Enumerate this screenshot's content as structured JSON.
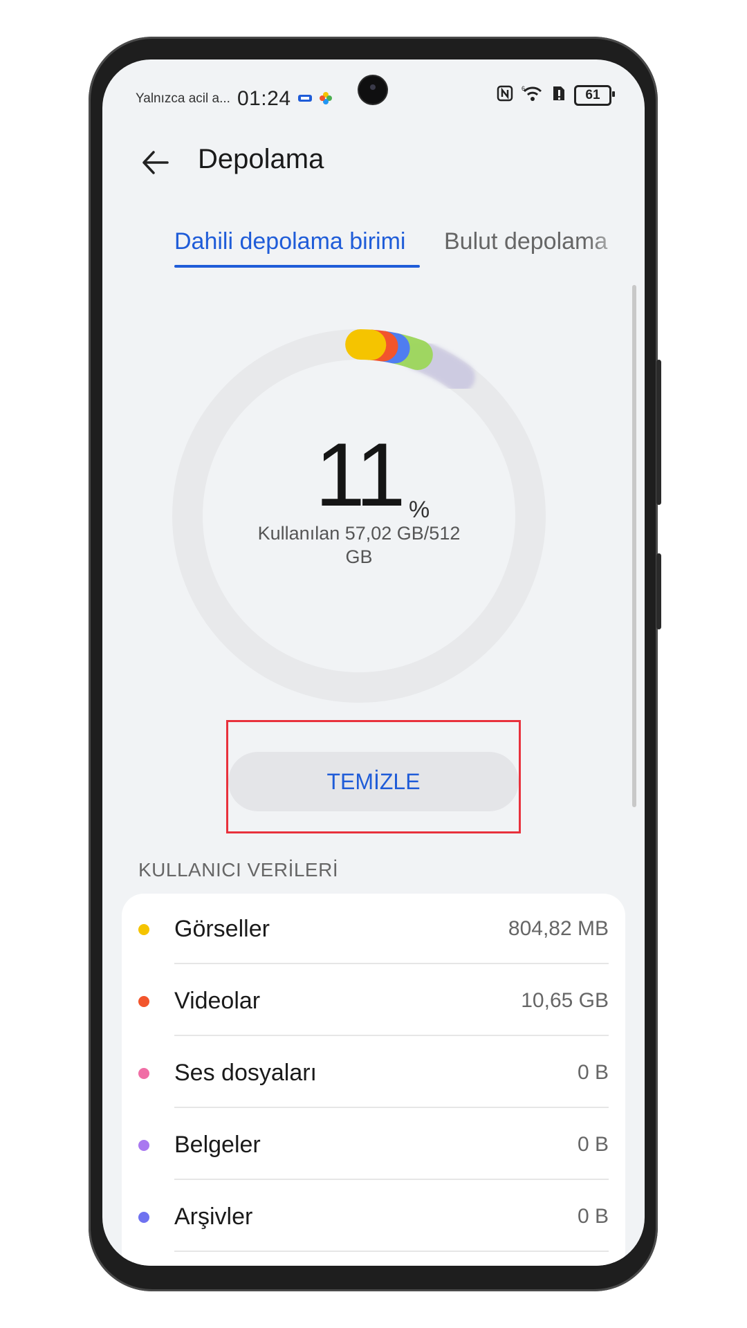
{
  "status_bar": {
    "carrier": "Yalnızca acil a...",
    "time": "01:24",
    "battery": "61"
  },
  "header": {
    "title": "Depolama",
    "back_icon": "arrow-left-icon"
  },
  "tabs": [
    {
      "label": "Dahili depolama birimi",
      "active": true
    },
    {
      "label": "Bulut depolama",
      "active": false
    }
  ],
  "summary": {
    "percent": "11",
    "percent_sign": "%",
    "usage": "Kullanılan 57,02 GB/512 GB"
  },
  "actions": {
    "clean_label": "TEMİZLE"
  },
  "section": {
    "title": "KULLANICI VERİLERİ"
  },
  "categories": [
    {
      "label": "Görseller",
      "value": "804,82 MB",
      "color": "#f5c400"
    },
    {
      "label": "Videolar",
      "value": "10,65 GB",
      "color": "#f2552c"
    },
    {
      "label": "Ses dosyaları",
      "value": "0 B",
      "color": "#f06ea5"
    },
    {
      "label": "Belgeler",
      "value": "0 B",
      "color": "#a978f0"
    },
    {
      "label": "Arşivler",
      "value": "0 B",
      "color": "#6f72f0"
    }
  ],
  "colors": {
    "accent": "#1f5cd8",
    "highlight": "#e8313c"
  }
}
